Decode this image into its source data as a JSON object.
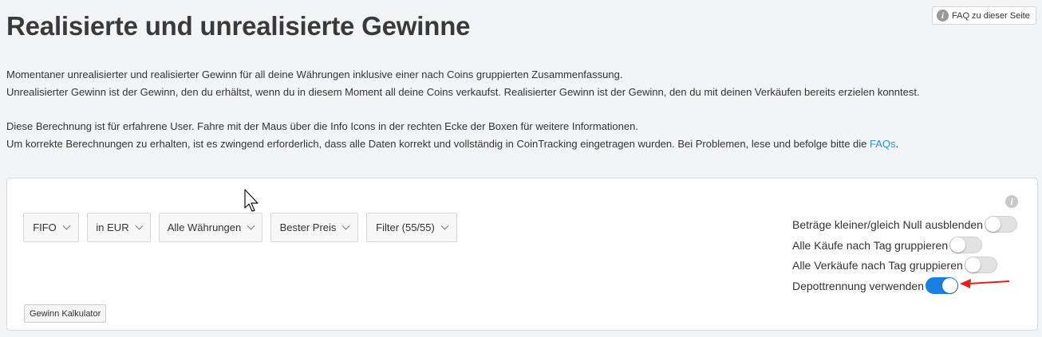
{
  "header": {
    "title": "Realisierte und unrealisierte Gewinne",
    "faq_button": "FAQ zu dieser Seite"
  },
  "description": {
    "line1": "Momentaner unrealisierter und realisierter Gewinn für all deine Währungen inklusive einer nach Coins gruppierten Zusammenfassung.",
    "line2": "Unrealisierter Gewinn ist der Gewinn, den du erhältst, wenn du in diesem Moment all deine Coins verkaufst. Realisierter Gewinn ist der Gewinn, den du mit deinen Verkäufen bereits erzielen konntest.",
    "line3": "Diese Berechnung ist für erfahrene User. Fahre mit der Maus über die Info Icons in der rechten Ecke der Boxen für weitere Informationen.",
    "line4_prefix": "Um korrekte Berechnungen zu erhalten, ist es zwingend erforderlich, dass alle Daten korrekt und vollständig in CoinTracking eingetragen wurden. Bei Problemen, lese und befolge bitte die ",
    "line4_link": "FAQs",
    "line4_suffix": "."
  },
  "filters": {
    "method": "FIFO",
    "currency": "in EUR",
    "coins": "Alle Währungen",
    "price": "Bester Preis",
    "filter": "Filter (55/55)"
  },
  "calculator_button": "Gewinn Kalkulator",
  "toggles": [
    {
      "label": "Beträge kleiner/gleich Null ausblenden",
      "on": false
    },
    {
      "label": "Alle Käufe nach Tag gruppieren",
      "on": false
    },
    {
      "label": "Alle Verkäufe nach Tag gruppieren",
      "on": false
    },
    {
      "label": "Depottrennung verwenden",
      "on": true
    }
  ],
  "colors": {
    "accent": "#1a7fe0",
    "link": "#2a8fd6",
    "annotation_arrow": "#e02020"
  }
}
